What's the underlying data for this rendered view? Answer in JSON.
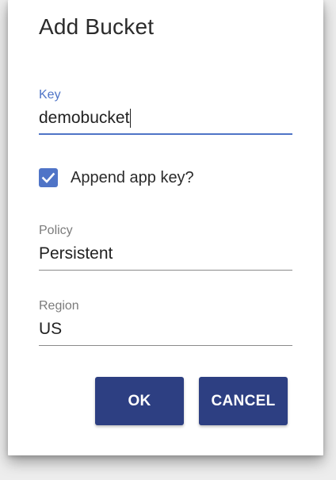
{
  "dialog": {
    "title": "Add Bucket"
  },
  "key_field": {
    "label": "Key",
    "value": "demobucket",
    "state": "focused"
  },
  "append_checkbox": {
    "label": "Append app key?",
    "checked": true
  },
  "policy_field": {
    "label": "Policy",
    "value": "Persistent"
  },
  "region_field": {
    "label": "Region",
    "value": "US"
  },
  "buttons": {
    "ok_label": "OK",
    "cancel_label": "CANCEL"
  },
  "colors": {
    "accent": "#4f74c7",
    "button_bg": "#2d3f82",
    "button_text": "#ffffff",
    "label_gray": "#7b7b7b"
  },
  "icons": {
    "checkbox": "check-icon"
  }
}
